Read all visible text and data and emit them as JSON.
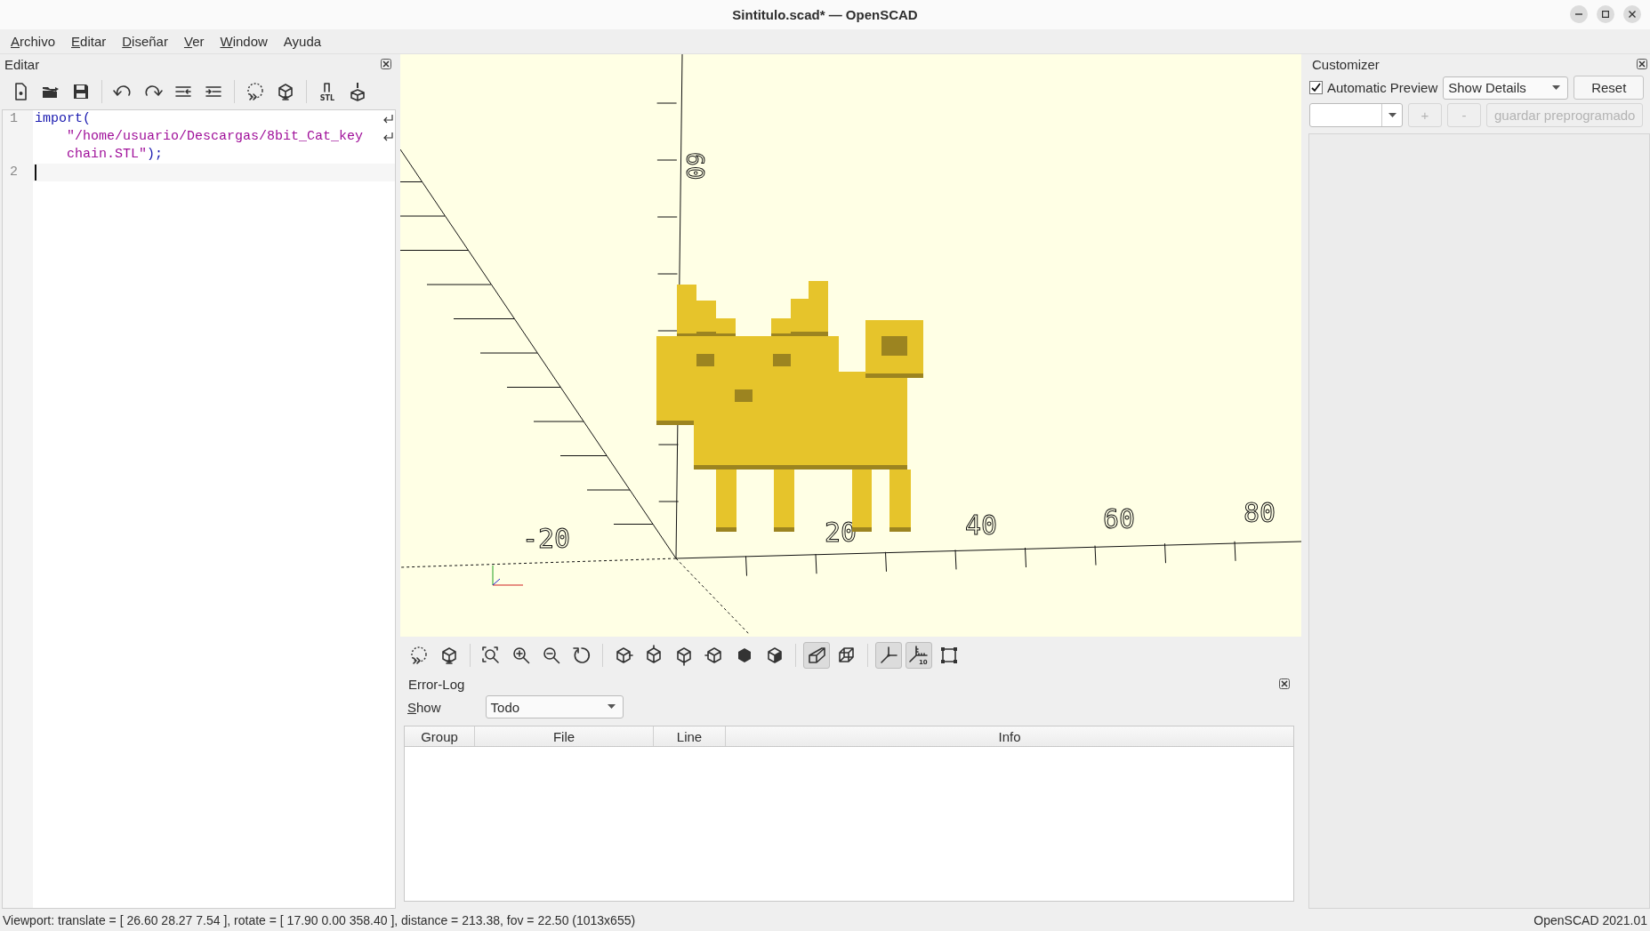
{
  "window": {
    "title": "Sintitulo.scad* — OpenSCAD"
  },
  "menu": [
    {
      "label": "Archivo",
      "mnemonic": true
    },
    {
      "label": "Editar",
      "mnemonic": true
    },
    {
      "label": "Diseñar",
      "mnemonic": true
    },
    {
      "label": "Ver",
      "mnemonic": true
    },
    {
      "label": "Window",
      "mnemonic": true
    },
    {
      "label": "Ayuda",
      "mnemonic": false
    }
  ],
  "editor_dock": {
    "title": "Editar",
    "toolbar": [
      {
        "kind": "new"
      },
      {
        "kind": "open"
      },
      {
        "kind": "save"
      },
      {
        "kind": "separator"
      },
      {
        "kind": "undo"
      },
      {
        "kind": "redo"
      },
      {
        "kind": "unindent"
      },
      {
        "kind": "indent"
      },
      {
        "kind": "separator"
      },
      {
        "kind": "preview"
      },
      {
        "kind": "render"
      },
      {
        "kind": "separator"
      },
      {
        "kind": "export-stl",
        "label": "STL"
      },
      {
        "kind": "print"
      }
    ],
    "lines": [
      {
        "number": "1",
        "current": false,
        "rows": [
          [
            {
              "text": "import(",
              "kind": "keyword"
            }
          ],
          [
            {
              "text": "\"/home/usuario/Descargas/8bit_Cat_key",
              "kind": "string"
            }
          ],
          [
            {
              "text": "chain.STL\"",
              "kind": "string"
            },
            {
              "text": ");",
              "kind": "punct"
            }
          ]
        ]
      },
      {
        "number": "2",
        "current": true
      }
    ]
  },
  "viewport": {
    "x_axis_labels": [
      "-20",
      "20",
      "40",
      "60",
      "80"
    ],
    "z_axis_labels": [
      "60"
    ],
    "toolbar": [
      {
        "kind": "preview",
        "selected": false
      },
      {
        "kind": "render",
        "selected": false
      },
      {
        "kind": "separator"
      },
      {
        "kind": "view-all",
        "selected": false
      },
      {
        "kind": "zoom-in",
        "selected": false
      },
      {
        "kind": "zoom-out",
        "selected": false
      },
      {
        "kind": "reset-view",
        "selected": false
      },
      {
        "kind": "separator"
      },
      {
        "kind": "view-right",
        "selected": false
      },
      {
        "kind": "view-top",
        "selected": false
      },
      {
        "kind": "view-bottom",
        "selected": false
      },
      {
        "kind": "view-left",
        "selected": false
      },
      {
        "kind": "view-front",
        "selected": false
      },
      {
        "kind": "view-back",
        "selected": false
      },
      {
        "kind": "separator"
      },
      {
        "kind": "perspective",
        "selected": true
      },
      {
        "kind": "orthogonal",
        "selected": false
      },
      {
        "kind": "separator"
      },
      {
        "kind": "axes",
        "selected": true
      },
      {
        "kind": "scale-markers",
        "selected": true,
        "label": "10"
      },
      {
        "kind": "edges",
        "selected": false
      }
    ]
  },
  "error_log": {
    "title": "Error-Log",
    "filter_label": "Show",
    "filter_value": "Todo",
    "columns": [
      "Group",
      "File",
      "Line",
      "Info"
    ]
  },
  "customizer": {
    "title": "Customizer",
    "automatic_preview": {
      "label": "Automatic Preview",
      "checked": true
    },
    "details": "Show Details",
    "reset": "Reset",
    "preset_add": "+",
    "preset_remove": "-",
    "preset_save": "guardar preprogramado",
    "preset_disabled": true
  },
  "status_bar": {
    "left": "Viewport: translate = [ 26.60 28.27 7.54 ], rotate = [ 17.90 0.00 358.40 ], distance = 213.38, fov = 22.50 (1013x655)",
    "right": "OpenSCAD 2021.01"
  }
}
